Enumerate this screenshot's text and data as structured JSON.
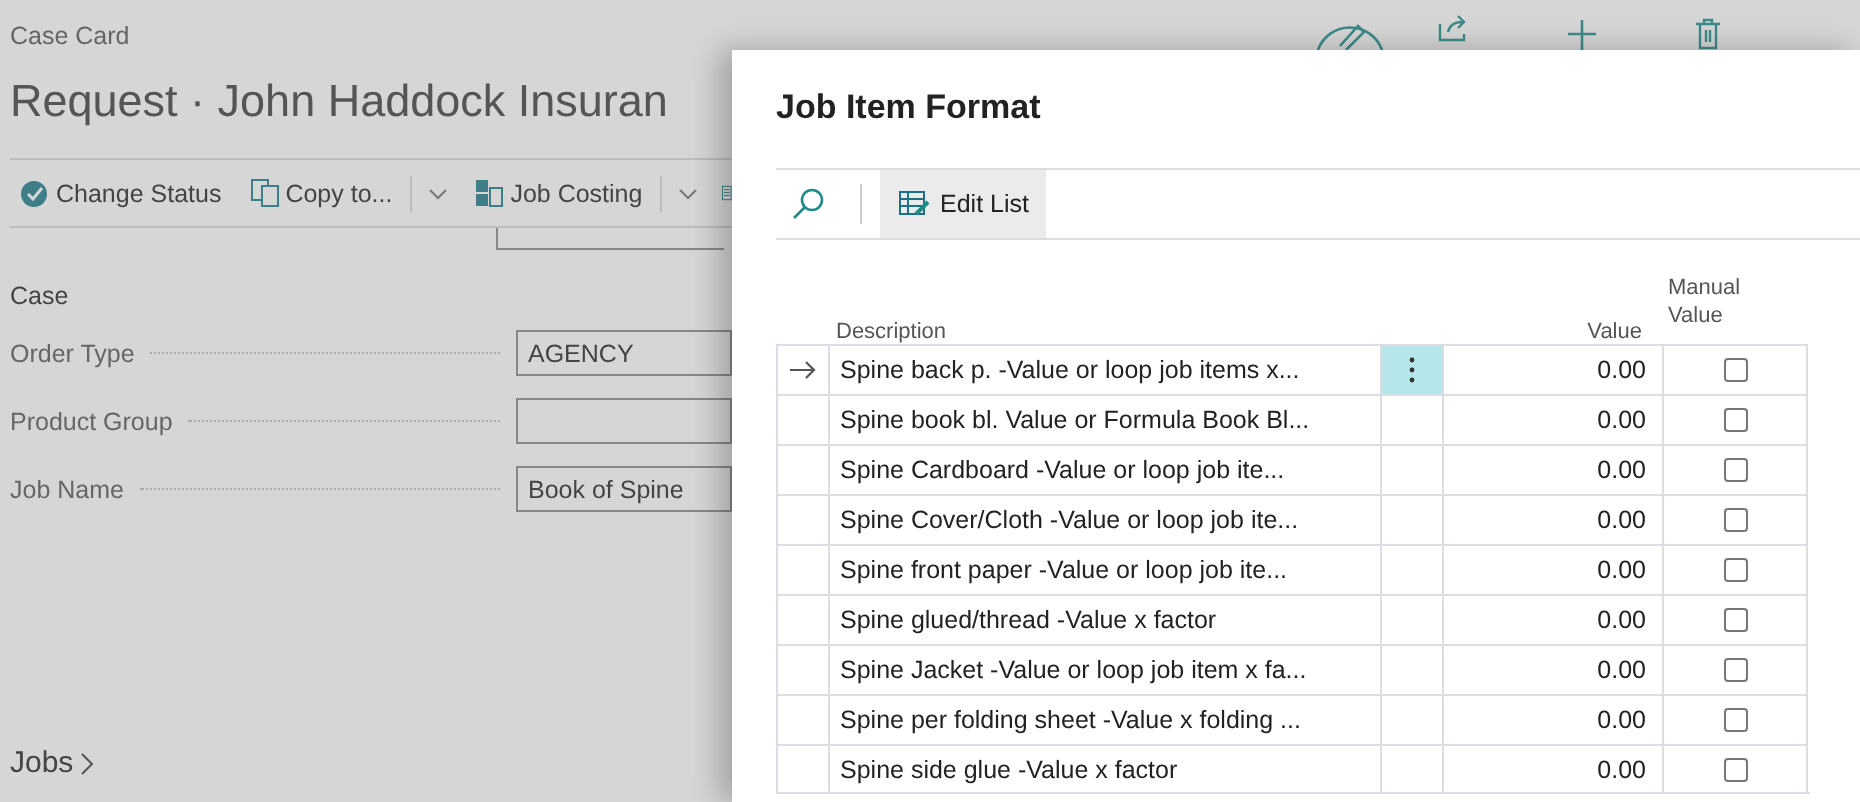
{
  "page": {
    "breadcrumb": "Case Card",
    "title": "Request · John Haddock Insuran",
    "actions": [
      {
        "label": "Change Status",
        "kind": "status",
        "dropdown": false
      },
      {
        "label": "Copy to...",
        "kind": "copy",
        "dropdown": true
      },
      {
        "label": "Job Costing",
        "kind": "costing",
        "dropdown": true
      }
    ],
    "section": "Case",
    "fields": [
      {
        "label": "Order Type",
        "value": "AGENCY"
      },
      {
        "label": "Product Group"
      },
      {
        "label": "Job Name",
        "value": "Book of Spine"
      }
    ],
    "jobs_link": "Jobs"
  },
  "dialog": {
    "title": "Job Item Format",
    "edit_button": "Edit List",
    "columns": {
      "description": "Description",
      "value": "Value",
      "manual_value": "Manual Value"
    },
    "rows": [
      {
        "description": "Spine back p. -Value or loop job items x...",
        "value": "0.00",
        "manual_value": false,
        "selected": true
      },
      {
        "description": "Spine book bl. Value or Formula Book Bl...",
        "value": "0.00",
        "manual_value": false,
        "selected": false
      },
      {
        "description": "Spine Cardboard -Value or loop job ite...",
        "value": "0.00",
        "manual_value": false,
        "selected": false
      },
      {
        "description": "Spine Cover/Cloth -Value or loop job ite...",
        "value": "0.00",
        "manual_value": false,
        "selected": false
      },
      {
        "description": "Spine front paper -Value or loop job ite...",
        "value": "0.00",
        "manual_value": false,
        "selected": false
      },
      {
        "description": "Spine glued/thread -Value x factor",
        "value": "0.00",
        "manual_value": false,
        "selected": false
      },
      {
        "description": "Spine Jacket -Value or loop job item x fa...",
        "value": "0.00",
        "manual_value": false,
        "selected": false
      },
      {
        "description": "Spine per folding sheet -Value x folding ...",
        "value": "0.00",
        "manual_value": false,
        "selected": false
      },
      {
        "description": "Spine side glue -Value x factor",
        "value": "0.00",
        "manual_value": false,
        "selected": false
      }
    ]
  }
}
